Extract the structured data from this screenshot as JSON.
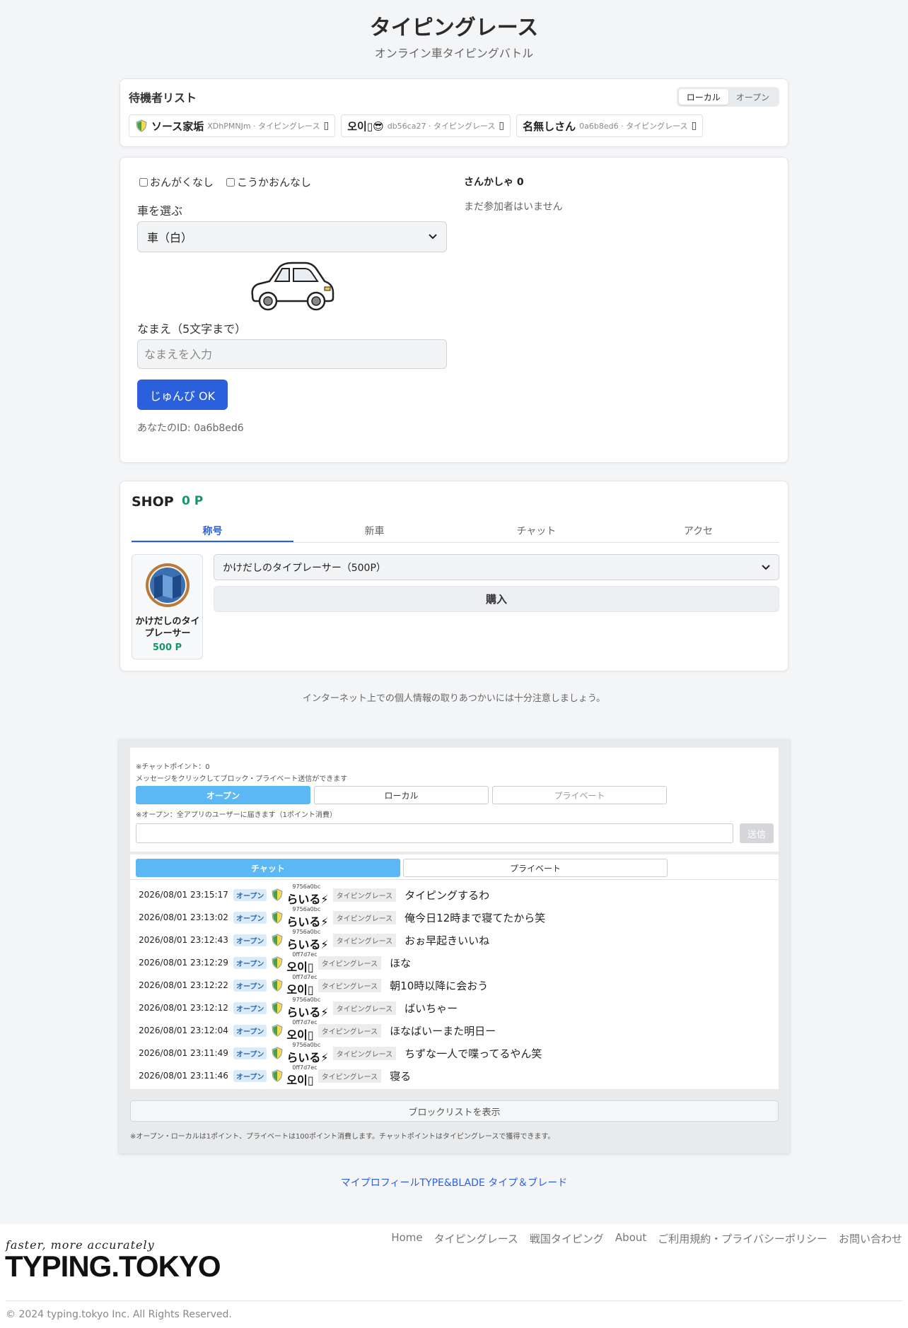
{
  "header": {
    "title": "タイピングレース",
    "subtitle": "オンライン車タイピングバトル"
  },
  "waiting": {
    "title": "待機者リスト",
    "toggle": [
      "ローカル",
      "オープン"
    ],
    "players": [
      {
        "name": "ソース家垢",
        "meta": "XDhPMNJm · タイピングレース",
        "box": "▯"
      },
      {
        "name": "오이▯😎",
        "meta": "db56ca27 · タイピングレース",
        "box": "▯"
      },
      {
        "name": "名無しさん",
        "meta": "0a6b8ed6 · タイピングレース",
        "box": "▯"
      }
    ]
  },
  "race": {
    "no_music": "おんがくなし",
    "no_sfx": "こうかおんなし",
    "car_label": "車を選ぶ",
    "car_value": "車（白）",
    "name_label": "なまえ（5文字まで）",
    "name_placeholder": "なまえを入力",
    "ready": "じゅんび OK",
    "my_id": "あなたのID: 0a6b8ed6",
    "participants_title": "さんかしゃ 0",
    "participants_empty": "まだ参加者はいません"
  },
  "shop": {
    "title": "SHOP",
    "points": "0 P",
    "tabs": [
      "称号",
      "新車",
      "チャット",
      "アクセ"
    ],
    "item_name": "かけだしのタイプレーサー",
    "item_price": "500 P",
    "select_value": "かけだしのタイプレーサー（500P）",
    "buy": "購入"
  },
  "notice": "インターネット上での個人情報の取りあつかいには十分注意しましょう。",
  "chat": {
    "points": "※チャットポイント：0",
    "hint": "メッセージをクリックしてブロック・プライベート送信ができます",
    "modes": [
      "オープン",
      "ローカル",
      "プライベート"
    ],
    "mode_note": "※オープン：全アプリのユーザーに届きます（1ポイント消費）",
    "send": "送信",
    "list_tabs": [
      "チャット",
      "プライベート"
    ],
    "messages": [
      {
        "time": "2026/08/01 23:15:17",
        "badge": "オープン",
        "uid": "9756a0bc",
        "user": "らいる⚡",
        "app": "タイピングレース",
        "text": "タイピングするわ"
      },
      {
        "time": "2026/08/01 23:13:02",
        "badge": "オープン",
        "uid": "9756a0bc",
        "user": "らいる⚡",
        "app": "タイピングレース",
        "text": "俺今日12時まで寝てたから笑"
      },
      {
        "time": "2026/08/01 23:12:43",
        "badge": "オープン",
        "uid": "9756a0bc",
        "user": "らいる⚡",
        "app": "タイピングレース",
        "text": "おぉ早起きいいね"
      },
      {
        "time": "2026/08/01 23:12:29",
        "badge": "オープン",
        "uid": "0ff7d7ec",
        "user": "오이▯",
        "app": "タイピングレース",
        "text": "ほな"
      },
      {
        "time": "2026/08/01 23:12:22",
        "badge": "オープン",
        "uid": "0ff7d7ec",
        "user": "오이▯",
        "app": "タイピングレース",
        "text": "朝10時以降に会おう"
      },
      {
        "time": "2026/08/01 23:12:12",
        "badge": "オープン",
        "uid": "9756a0bc",
        "user": "らいる⚡",
        "app": "タイピングレース",
        "text": "ばいちゃー"
      },
      {
        "time": "2026/08/01 23:12:04",
        "badge": "オープン",
        "uid": "0ff7d7ec",
        "user": "오이▯",
        "app": "タイピングレース",
        "text": "ほなばいーまた明日ー"
      },
      {
        "time": "2026/08/01 23:11:49",
        "badge": "オープン",
        "uid": "9756a0bc",
        "user": "らいる⚡",
        "app": "タイピングレース",
        "text": "ちずな一人で喋ってるやん笑"
      },
      {
        "time": "2026/08/01 23:11:46",
        "badge": "オープン",
        "uid": "0ff7d7ec",
        "user": "오이▯",
        "app": "タイピングレース",
        "text": "寝る"
      }
    ],
    "block_list": "ブロックリストを表示",
    "footer_note": "※オープン・ローカルは1ポイント、プライベートは100ポイント消費します。チャットポイントはタイピングレースで獲得できます。"
  },
  "links": "マイプロフィールTYPE&BLADE タイプ＆ブレード",
  "footer": {
    "tagline": "faster, more accurately",
    "logo": "TYPING.TOKYO",
    "nav": [
      "Home",
      "タイピングレース",
      "戦国タイピング",
      "About",
      "ご利用規約・プライバシーポリシー",
      "お問い合わせ"
    ],
    "copyright": "© 2024 typing.tokyo Inc. All Rights Reserved."
  },
  "colors": {
    "accent": "#2b5fdc",
    "points_green": "#17946a",
    "chat_tab": "#5bb8f4"
  }
}
